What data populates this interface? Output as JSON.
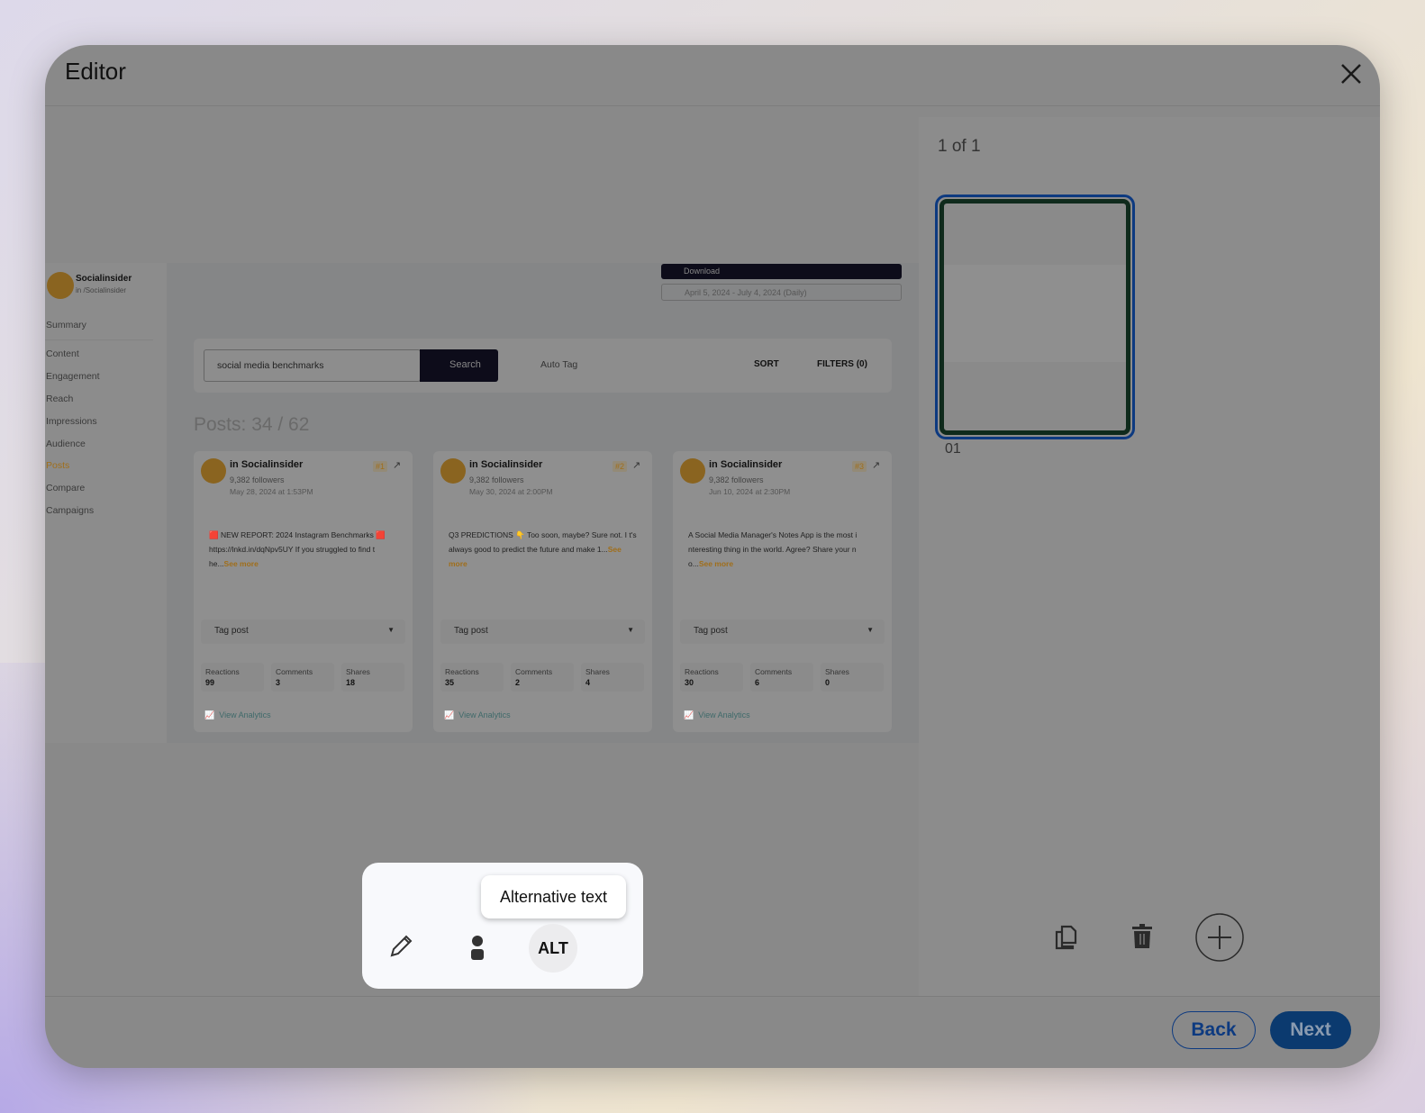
{
  "editor": {
    "title": "Editor",
    "close_icon": "close-icon"
  },
  "embedded": {
    "account": {
      "name": "Socialinsider",
      "handle": "/Socialinsider",
      "network": "in"
    },
    "nav": [
      "Summary",
      "Content",
      "Engagement",
      "Reach",
      "Impressions",
      "Audience",
      "Posts",
      "Compare",
      "Campaigns"
    ],
    "active_nav": "Posts",
    "download_label": "Download",
    "date_range": "April 5, 2024 - July 4, 2024 (Daily)",
    "search_value": "social media benchmarks",
    "search_button": "Search",
    "auto_tag": "Auto Tag",
    "sort": "SORT",
    "filters": "FILTERS (0)",
    "posts_count": "Posts: 34 / 62",
    "accent": "#c98a1e",
    "cards": [
      {
        "network": "in",
        "name": "Socialinsider",
        "followers": "9,382 followers",
        "date": "May 28, 2024 at 1:53PM",
        "rank": "#1",
        "text": "🟥 NEW REPORT: 2024 Instagram Benchmarks 🟥 https://lnkd.in/dqNpv5UY If you struggled to find t he...",
        "see_more": "See more",
        "tag": "Tag post",
        "stats": [
          {
            "label": "Reactions",
            "value": "99"
          },
          {
            "label": "Comments",
            "value": "3"
          },
          {
            "label": "Shares",
            "value": "18"
          }
        ],
        "analytics": "View Analytics"
      },
      {
        "network": "in",
        "name": "Socialinsider",
        "followers": "9,382 followers",
        "date": "May 30, 2024 at 2:00PM",
        "rank": "#2",
        "text": "Q3 PREDICTIONS 👇 Too soon, maybe? Sure not. I t's always good to predict the future and make 1...",
        "see_more": "See more",
        "tag": "Tag post",
        "stats": [
          {
            "label": "Reactions",
            "value": "35"
          },
          {
            "label": "Comments",
            "value": "2"
          },
          {
            "label": "Shares",
            "value": "4"
          }
        ],
        "analytics": "View Analytics"
      },
      {
        "network": "in",
        "name": "Socialinsider",
        "followers": "9,382 followers",
        "date": "Jun 10, 2024 at 2:30PM",
        "rank": "#3",
        "text": "A Social Media Manager's Notes App is the most i nteresting thing in the world. Agree? Share your n o...",
        "see_more": "See more",
        "tag": "Tag post",
        "stats": [
          {
            "label": "Reactions",
            "value": "30"
          },
          {
            "label": "Comments",
            "value": "6"
          },
          {
            "label": "Shares",
            "value": "0"
          }
        ],
        "analytics": "View Analytics"
      }
    ]
  },
  "toolbar": {
    "tooltip": "Alternative text",
    "alt_label": "ALT",
    "icons": [
      "pencil-icon",
      "person-icon",
      "alt-text-icon"
    ]
  },
  "pages": {
    "counter": "1 of 1",
    "thumb_label": "01",
    "icons": [
      "duplicate-icon",
      "trash-icon",
      "add-icon"
    ]
  },
  "footer": {
    "back": "Back",
    "next": "Next",
    "accent": "#0b3a6f"
  }
}
